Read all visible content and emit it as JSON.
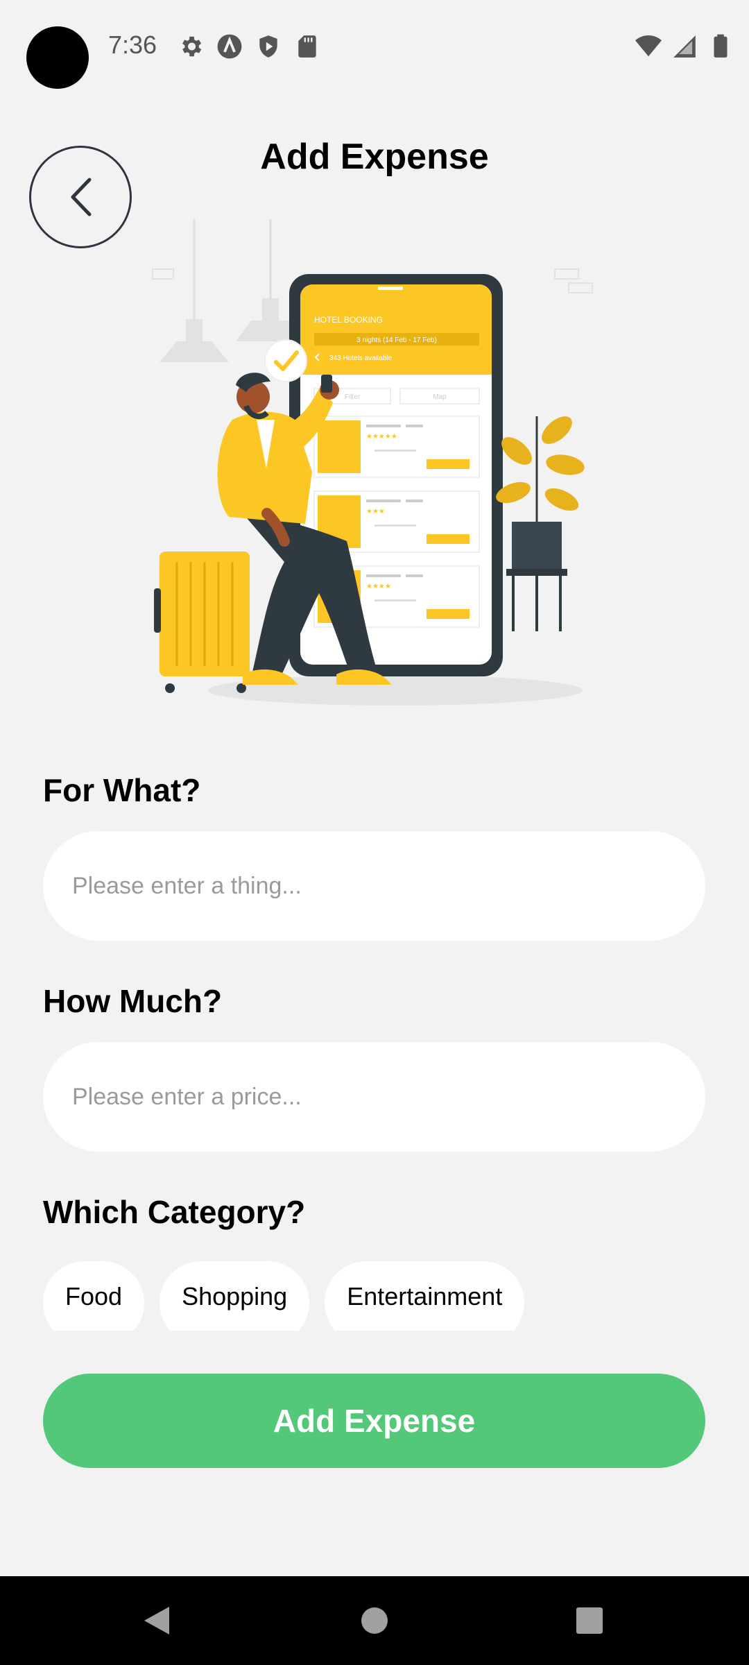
{
  "status_bar": {
    "time": "7:36",
    "left_icons": [
      "settings-icon",
      "app-a-icon",
      "shield-play-icon",
      "sd-card-icon"
    ],
    "right_icons": [
      "wifi-icon",
      "signal-icon",
      "battery-icon"
    ]
  },
  "header": {
    "title": "Add Expense",
    "back_icon": "chevron-left-icon"
  },
  "illustration": {
    "phone_header": "HOTEL BOOKING",
    "phone_dates": "3 nights (14 Feb - 17 Feb)",
    "phone_count": "343 Hotels available",
    "phone_filter": "Filter",
    "phone_map": "Map"
  },
  "form": {
    "for_what_label": "For What?",
    "for_what_placeholder": "Please enter a thing...",
    "for_what_value": "",
    "how_much_label": "How Much?",
    "how_much_placeholder": "Please enter a price...",
    "how_much_value": "",
    "category_label": "Which Category?",
    "categories": [
      "Food",
      "Shopping",
      "Entertainment"
    ]
  },
  "submit_label": "Add Expense",
  "colors": {
    "background": "#f2f2f2",
    "accent_green": "#52c878",
    "illustration_yellow": "#fcc624",
    "dark": "#2e3440"
  },
  "nav_bar": [
    "back-triangle-icon",
    "home-circle-icon",
    "recents-square-icon"
  ]
}
